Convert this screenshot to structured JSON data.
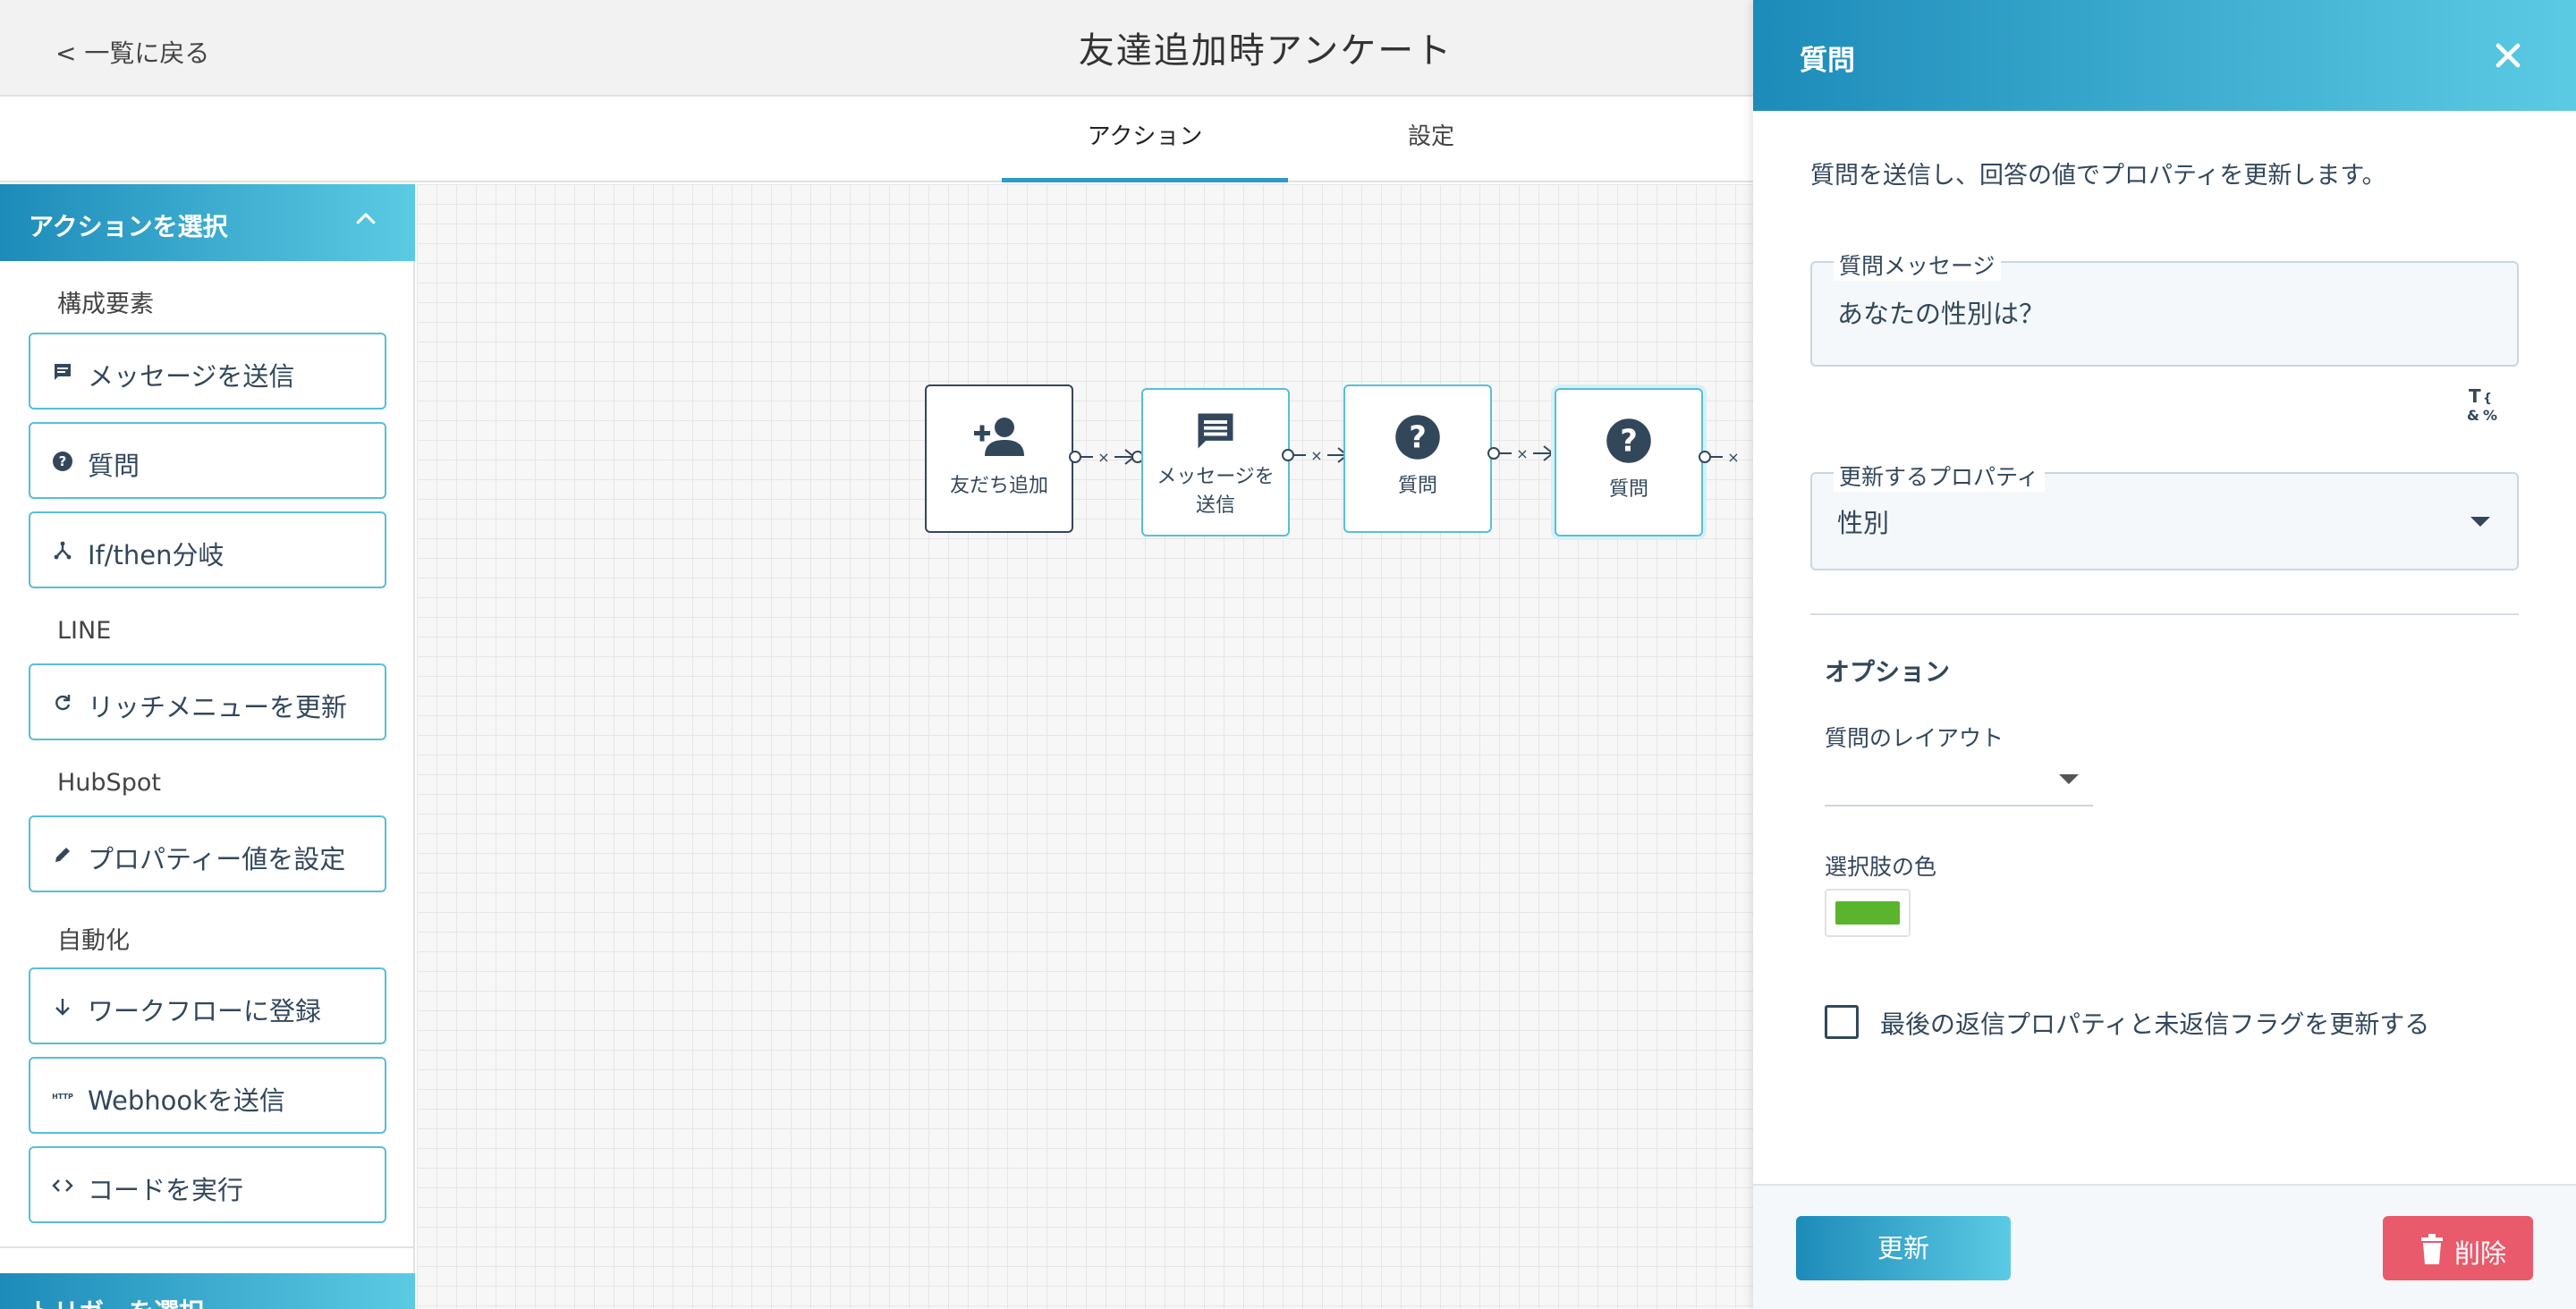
{
  "header": {
    "back_label": "< 一覧に戻る",
    "title": "友達追加時アンケート"
  },
  "tabs": [
    {
      "label": "アクション",
      "active": true
    },
    {
      "label": "設定",
      "active": false
    }
  ],
  "sidebar": {
    "panel_title": "アクションを選択",
    "sections": [
      {
        "label": "構成要素",
        "items": [
          {
            "label": "メッセージを送信",
            "icon": "message-icon"
          },
          {
            "label": "質問",
            "icon": "question-icon"
          },
          {
            "label": "If/then分岐",
            "icon": "branch-icon"
          }
        ]
      },
      {
        "label": "LINE",
        "items": [
          {
            "label": "リッチメニューを更新",
            "icon": "refresh-icon"
          }
        ]
      },
      {
        "label": "HubSpot",
        "items": [
          {
            "label": "プロパティー値を設定",
            "icon": "pencil-icon"
          }
        ]
      },
      {
        "label": "自動化",
        "items": [
          {
            "label": "ワークフローに登録",
            "icon": "arrow-down-icon"
          },
          {
            "label": "Webhookを送信",
            "icon": "http-icon"
          },
          {
            "label": "コードを実行",
            "icon": "code-icon"
          }
        ]
      }
    ],
    "second_panel_title": "トリガーを選択"
  },
  "canvas": {
    "nodes": [
      {
        "label": "友だち追加",
        "icon": "add-friend-icon"
      },
      {
        "label": "メッセージを送信",
        "icon": "message-icon"
      },
      {
        "label": "質問",
        "icon": "question-icon"
      },
      {
        "label": "質問",
        "icon": "question-icon"
      }
    ],
    "connector_glyph": "×"
  },
  "panel": {
    "title": "質問",
    "description": "質問を送信し、回答の値でプロパティを更新します。",
    "question_message": {
      "label": "質問メッセージ",
      "value": "あなたの性別は？"
    },
    "property": {
      "label": "更新するプロパティ",
      "value": "性別"
    },
    "options_title": "オプション",
    "layout_label": "質問のレイアウト",
    "layout_value": "",
    "color_label": "選択肢の色",
    "color_value": "#5ab52d",
    "checkbox_label": "最後の返信プロパティと未返信フラグを更新する",
    "checkbox_checked": false,
    "update_button": "更新",
    "delete_button": "削除"
  },
  "colors": {
    "accent_start": "#1d8bb9",
    "accent_end": "#5bcbe4",
    "delete": "#e85a6c",
    "text": "#33475b"
  }
}
